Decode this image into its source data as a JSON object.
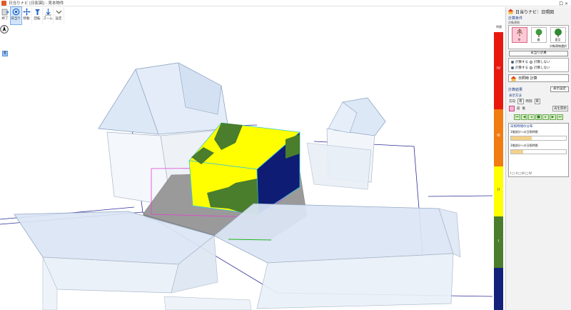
{
  "window": {
    "title": "日当りナビ [日影図] - 見本物件",
    "controls": "口 ✕"
  },
  "toolbar": {
    "items": [
      {
        "label": "終了",
        "icon": "exit-icon"
      },
      {
        "label": "日当り",
        "icon": "sun-icon",
        "active": true
      },
      {
        "label": "移動",
        "icon": "move-icon"
      },
      {
        "label": "回転",
        "icon": "rotate-icon"
      },
      {
        "label": "ズーム",
        "icon": "zoom-icon"
      },
      {
        "label": "設定",
        "icon": "settings-icon"
      }
    ]
  },
  "viewport": {
    "season_tag": "冬",
    "compass_label": "N"
  },
  "legend": {
    "unit": "時間",
    "ticks": [
      "",
      "",
      "",
      "",
      ""
    ],
    "classes": [
      {
        "label": "IV",
        "color": "#e8180f"
      },
      {
        "label": "III",
        "color": "#f07c12"
      },
      {
        "label": "II",
        "color": "#ffff00"
      },
      {
        "label": "I",
        "color": "#4a7d2c"
      },
      {
        "label": "",
        "color": "#13217b"
      }
    ]
  },
  "panel": {
    "header_title": "日当りナビ：日照図",
    "calc_conditions_label": "計算条件",
    "calc_target": "対象建物",
    "season_buttons": [
      {
        "label": "冬",
        "selected": true
      },
      {
        "label": "春",
        "selected": false
      },
      {
        "label": "夏至"
      }
    ],
    "target_building_button": "対象建物選択",
    "date_button": "日当り計算",
    "option1": {
      "on": "計算する",
      "off": "計算しない"
    },
    "option2": {
      "on": "計算する",
      "off": "計算しない"
    },
    "calc_button": "日照時 計算",
    "result_label": "計算結果",
    "result_detail_button": "表示設定",
    "display_label": "表示方法",
    "direction_label": "方向",
    "direction_value": "南",
    "time_label": "時刻",
    "time_value": "東",
    "prev_label": "前",
    "next_label": "後",
    "animate_button": "再生開始",
    "chart_title": "日照時間の分布",
    "chart_row1": "1階部分への日照時間",
    "chart_row2": "2階部分への日照時間",
    "legend_line": "I □ II □ III □ IV"
  }
}
